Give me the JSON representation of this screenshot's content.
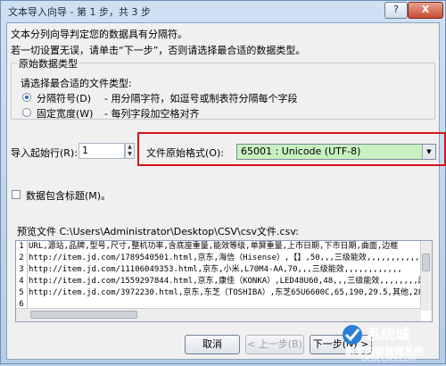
{
  "window": {
    "title": "文本导入向导 - 第 1 步，共 3 步",
    "help_label": "?",
    "close_label": "X"
  },
  "intro": {
    "line1": "文本分列向导判定您的数据具有分隔符。",
    "line2": "若一切设置无误，请单击“下一步”，否则请选择最合适的数据类型。"
  },
  "data_type_group": {
    "legend": "原始数据类型",
    "prompt": "请选择最合适的文件类型:",
    "options": [
      {
        "label": "分隔符号(D)",
        "desc": "- 用分隔字符，如逗号或制表符分隔每个字段",
        "selected": true
      },
      {
        "label": "固定宽度(W)",
        "desc": "- 每列字段加空格对齐",
        "selected": false
      }
    ]
  },
  "start_row": {
    "label": "导入起始行(R):",
    "value": "1"
  },
  "file_origin": {
    "label": "文件原始格式(O):",
    "value": "65001 : Unicode (UTF-8)"
  },
  "headers_checkbox": {
    "label": "数据包含标题(M)。",
    "checked": false
  },
  "preview": {
    "label": "预览文件 C:\\Users\\Administrator\\Desktop\\CSV\\csv文件.csv:",
    "line_numbers": [
      "1",
      "2",
      "3",
      "4",
      "5",
      "6",
      "7"
    ],
    "rows": [
      "URL,源站,品牌,型号,尺寸,整机功率,含底座重量,能效等级,单屏重量,上市日期,下市日期,曲面,边框",
      "http://item.jd.com/1789540501.html,京东,海信（Hisense）,【】,50,,,三级能效,,,,,,,,,,,,,超薄",
      "http://item.jd.com/11106049353.html,京东,小米,L70M4-AA,70,,,三级能效,,,,,,,,,,,,",
      "http://item.jd.com/1559297844.html,京东,康佳（KONKA）,LED48U60,48,,,三级能效,,,,,,,,超高清4K",
      "http://item.jd.com/3972230.html,京东,东芝（TOSHIBA）,东芝65U6600C,65,190,29.5,其他,28.1,20",
      "",
      ""
    ]
  },
  "buttons": {
    "cancel": "取消",
    "back": "< 上一步(B)",
    "next": "下一步(N) >"
  },
  "watermark": {
    "brand": "系统城",
    "tagline": "织梦内容管理系统",
    "domain": "DEDECMS.COM"
  },
  "colors": {
    "highlight_border": "#d4141a",
    "select_fill": "#c8f0c0",
    "title_bar": "#b6cde7"
  }
}
